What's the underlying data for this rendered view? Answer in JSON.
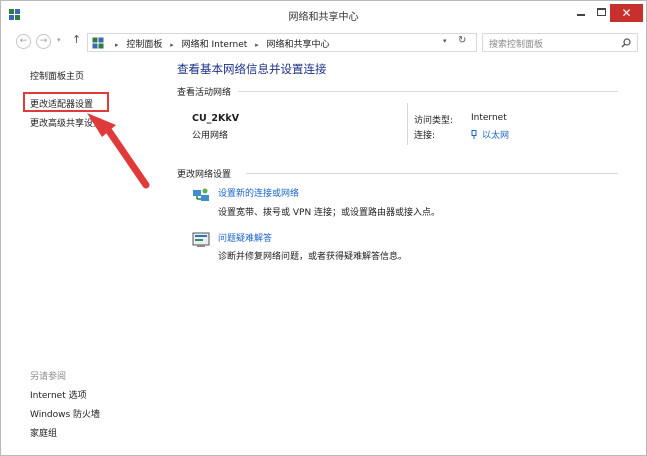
{
  "window": {
    "title": "网络和共享中心",
    "close_glyph": "✕"
  },
  "address": {
    "crumbs": [
      "控制面板",
      "网络和 Internet",
      "网络和共享中心"
    ],
    "search_placeholder": "搜索控制面板"
  },
  "nav": {
    "back_glyph": "←",
    "forward_glyph": "→",
    "dropdown_glyph": "▾",
    "up_glyph": "↑",
    "separator_glyph": "▸",
    "refresh_glyph": "↻"
  },
  "left_pane": {
    "home": "控制面板主页",
    "adapter_settings": "更改适配器设置",
    "advanced_sharing": "更改高级共享设置",
    "see_also_title": "另请参阅",
    "see_also": [
      "Internet 选项",
      "Windows 防火墙",
      "家庭组"
    ]
  },
  "main": {
    "title": "查看基本网络信息并设置连接",
    "active_networks_label": "查看活动网络",
    "network": {
      "name": "CU_2KkV",
      "category": "公用网络",
      "access_type_label": "访问类型:",
      "access_type_value": "Internet",
      "connections_label": "连接:",
      "connections_value": "以太网"
    },
    "change_settings_label": "更改网络设置",
    "tasks": [
      {
        "title": "设置新的连接或网络",
        "description": "设置宽带、拨号或 VPN 连接；或设置路由器或接入点。",
        "icon": "network-setup-icon"
      },
      {
        "title": "问题疑难解答",
        "description": "诊断并修复网络问题，或者获得疑难解答信息。",
        "icon": "troubleshoot-icon"
      }
    ]
  },
  "colors": {
    "annotation": "#e03b3b",
    "link": "#1b64c8",
    "heading": "#1e3287",
    "close_button": "#c7302b"
  }
}
